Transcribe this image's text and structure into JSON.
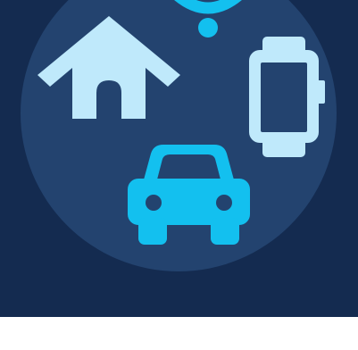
{
  "hero": {
    "background_color": "#142b50",
    "circle_color": "#23436f",
    "light_icon_color": "#bfe9fb",
    "accent_icon_color": "#13c0ef",
    "icons": [
      "home-icon",
      "wifi-icon",
      "smartwatch-icon",
      "car-icon"
    ]
  },
  "caption": {
    "text": "",
    "color": "#142b50"
  }
}
